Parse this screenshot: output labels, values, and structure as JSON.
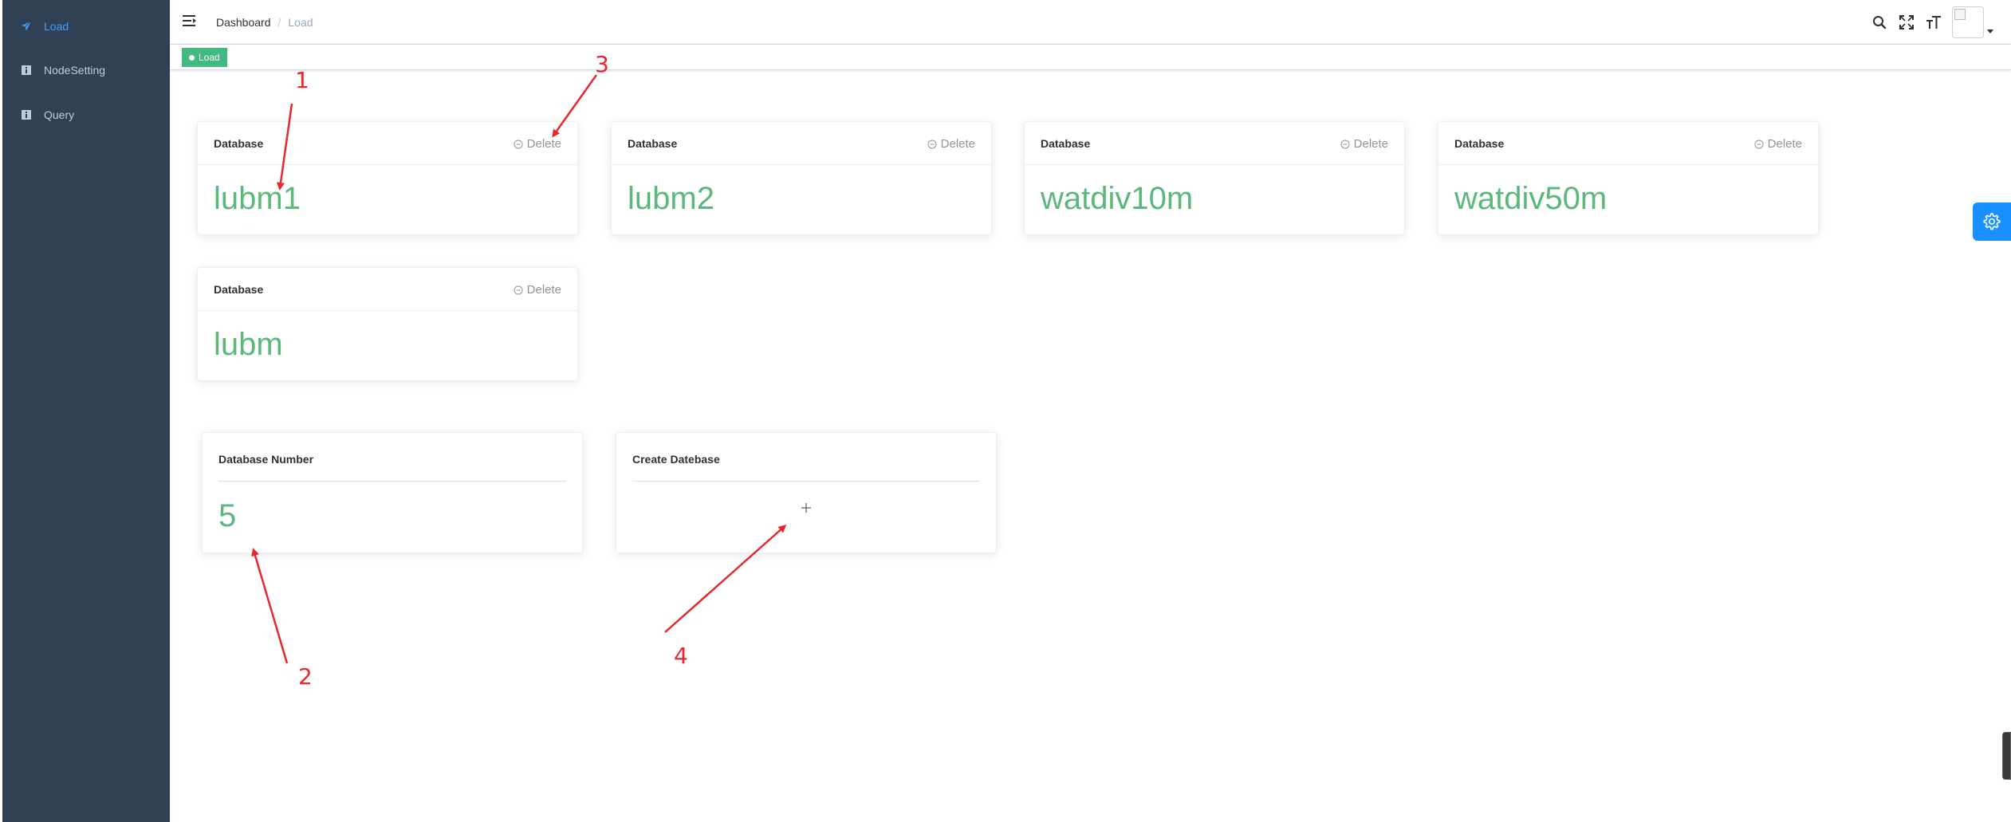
{
  "sidebar": {
    "items": [
      {
        "label": "Load",
        "icon": "paper-plane-icon",
        "active": true
      },
      {
        "label": "NodeSetting",
        "icon": "info-icon",
        "active": false
      },
      {
        "label": "Query",
        "icon": "info-icon",
        "active": false
      }
    ]
  },
  "navbar": {
    "breadcrumb": [
      "Dashboard",
      "Load"
    ],
    "separator": "/",
    "icons": [
      "search-icon",
      "fullscreen-icon",
      "font-size-icon",
      "avatar",
      "caret-down-icon"
    ]
  },
  "tags_view": {
    "tags": [
      {
        "label": "Load",
        "active": true
      }
    ]
  },
  "databases": {
    "header_label": "Database",
    "delete_label": "Delete",
    "items": [
      {
        "name": "lubm1"
      },
      {
        "name": "lubm2"
      },
      {
        "name": "watdiv10m"
      },
      {
        "name": "watdiv50m"
      },
      {
        "name": "lubm"
      }
    ]
  },
  "stats": {
    "db_number_label": "Database Number",
    "db_number_value": "5",
    "create_label": "Create Datebase",
    "create_icon": "plus-icon"
  },
  "annotations": [
    "1",
    "2",
    "3",
    "4"
  ],
  "colors": {
    "sidebar_bg": "#304156",
    "sidebar_text": "#bfcbd9",
    "active_menu": "#409eff",
    "tag_bg": "#42b983",
    "db_value": "#5cb87a",
    "settings_button": "#1890ff",
    "annotation": "#e8262b"
  }
}
